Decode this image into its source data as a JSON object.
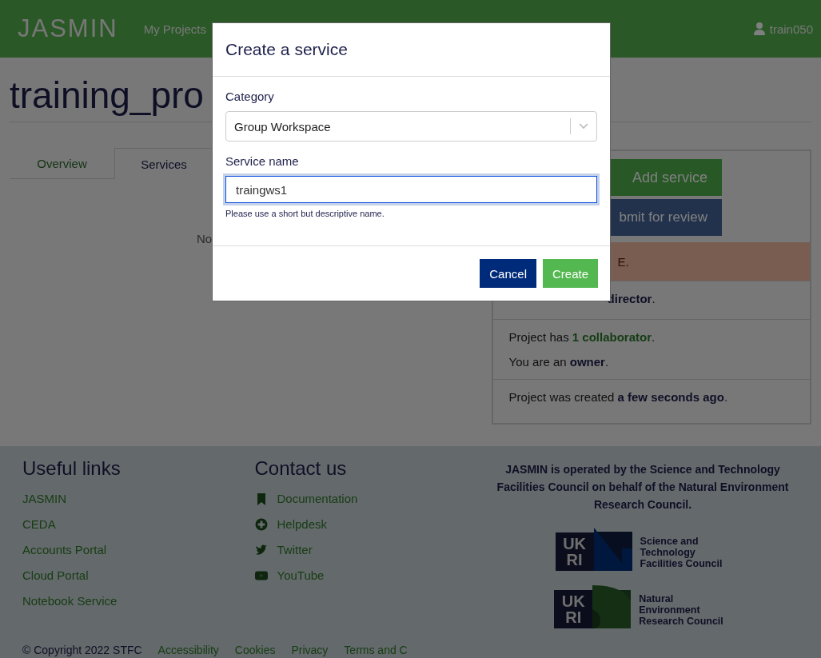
{
  "header": {
    "logo": "JASMIN",
    "nav": [
      {
        "label": "My Projects"
      }
    ],
    "user": "train050"
  },
  "page": {
    "title": "training_pro",
    "tabs": [
      {
        "label": "Overview",
        "selected": false
      },
      {
        "label": "Services",
        "selected": true
      }
    ],
    "empty_text": "No"
  },
  "panel": {
    "buttons": [
      {
        "label": "Add service",
        "kind": "primary"
      },
      {
        "label": "bmit for review",
        "kind": "secondary"
      }
    ],
    "alert": "E.",
    "rows": [
      {
        "lines": [
          [
            {
              "text": "director",
              "kind": "bold"
            },
            {
              "text": ".",
              "kind": "plain"
            }
          ]
        ]
      },
      {
        "lines": [
          [
            {
              "text": "Project has ",
              "kind": "plain"
            },
            {
              "text": "1 collaborator",
              "kind": "link"
            },
            {
              "text": ".",
              "kind": "plain"
            }
          ],
          [
            {
              "text": "You are an ",
              "kind": "plain"
            },
            {
              "text": "owner",
              "kind": "bold"
            },
            {
              "text": ".",
              "kind": "plain"
            }
          ]
        ]
      },
      {
        "lines": [
          [
            {
              "text": "Project was created ",
              "kind": "plain"
            },
            {
              "text": "a few seconds ago",
              "kind": "bold"
            },
            {
              "text": ".",
              "kind": "plain"
            }
          ]
        ]
      }
    ]
  },
  "modal": {
    "title": "Create a service",
    "fields": [
      {
        "label": "Category",
        "kind": "select",
        "value": "Group Workspace"
      },
      {
        "label": "Service name",
        "kind": "text",
        "value": "traingws1",
        "focused": true,
        "help": "Please use a short but descriptive name."
      }
    ],
    "buttons": [
      {
        "label": "Cancel",
        "kind": "secondary"
      },
      {
        "label": "Create",
        "kind": "primary"
      }
    ]
  },
  "footer": {
    "useful_links": {
      "title": "Useful links",
      "items": [
        "JASMIN",
        "CEDA",
        "Accounts Portal",
        "Cloud Portal",
        "Notebook Service"
      ]
    },
    "contact": {
      "title": "Contact us",
      "items": [
        {
          "label": "Documentation",
          "kind": "bookmark"
        },
        {
          "label": "Helpdesk",
          "kind": "lifebuoy"
        },
        {
          "label": "Twitter",
          "kind": "bird"
        },
        {
          "label": "YouTube",
          "kind": "play"
        }
      ]
    },
    "statement": "JASMIN is operated by the Science and Technology Facilities Council on behalf of the Natural Environment Research Council.",
    "logos": [
      {
        "kind": "stfc",
        "mark_top": "UK",
        "mark_bottom": "RI",
        "lines": [
          "Science and",
          "Technology",
          "Facilities Council"
        ]
      },
      {
        "kind": "nerc",
        "mark_top": "UK",
        "mark_bottom": "RI",
        "lines": [
          "Natural",
          "Environment",
          "Research Council"
        ]
      }
    ],
    "bottom_links": [
      "© Copyright 2022 STFC",
      "Accessibility",
      "Cookies",
      "Privacy",
      "Terms and C"
    ]
  }
}
